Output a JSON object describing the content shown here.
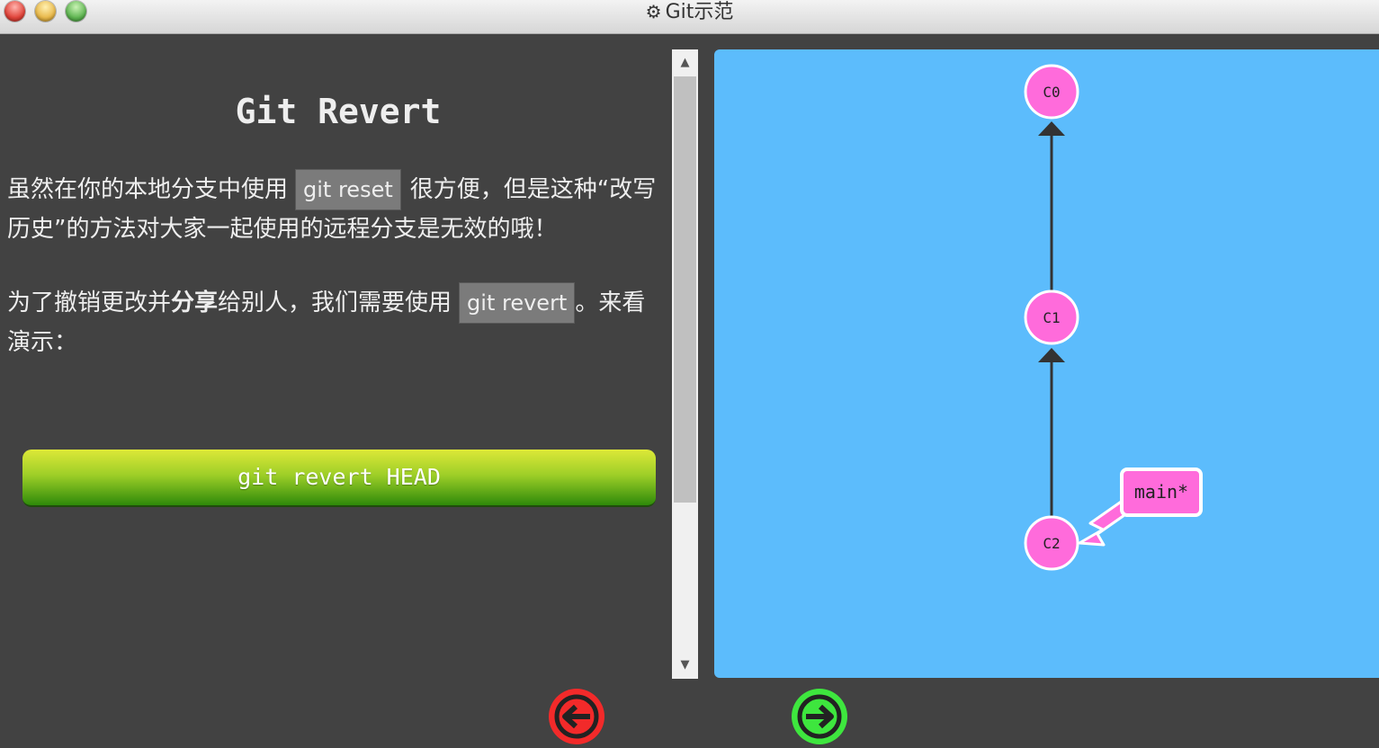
{
  "window": {
    "title": "Git示范",
    "title_icon": "gear-icon"
  },
  "lesson": {
    "heading": "Git Revert",
    "p1_before": "虽然在你的本地分支中使用",
    "p1_code": "git reset",
    "p1_after": "很方便，但是这种“改写历史”的方法对大家一起使用的远程分支是无效的哦！",
    "p2_before": "为了撤销更改并",
    "p2_bold": "分享",
    "p2_middle": "给别人，我们需要使用",
    "p2_code": "git revert",
    "p2_after": "。来看演示：",
    "command_button": "git revert HEAD"
  },
  "graph": {
    "commits": [
      "C0",
      "C1",
      "C2"
    ],
    "branch": "main*",
    "colors": {
      "background": "#5cbcfc",
      "commit_fill": "#ff6bdb",
      "edge": "#333333"
    }
  },
  "nav": {
    "prev_icon": "arrow-left-icon",
    "next_icon": "arrow-right-icon",
    "prev_color": "#f22a2a",
    "next_color": "#3ee63e"
  }
}
